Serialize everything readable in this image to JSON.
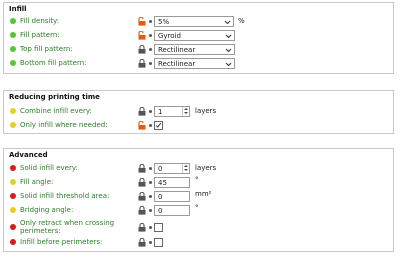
{
  "colors": {
    "dot_green": "#59c33b",
    "dot_yellow": "#e3cf2b",
    "dot_red": "#d11f1f",
    "label_green": "#2f7d2a",
    "lock_open": "#e15a13",
    "lock_closed": "#555555"
  },
  "infill": {
    "title": "Infill",
    "rows": [
      {
        "label": "Fill density:",
        "value": "5%",
        "unit": "%",
        "dot": "green",
        "lock": "open"
      },
      {
        "label": "Fill pattern:",
        "value": "Gyroid",
        "dot": "green",
        "lock": "open"
      },
      {
        "label": "Top fill pattern:",
        "value": "Rectilinear",
        "dot": "green",
        "lock": "closed"
      },
      {
        "label": "Bottom fill pattern:",
        "value": "Rectilinear",
        "dot": "green",
        "lock": "closed"
      }
    ]
  },
  "reducing": {
    "title": "Reducing printing time",
    "rows": [
      {
        "label": "Combine infill every:",
        "value": "1",
        "unit": "layers",
        "dot": "yellow",
        "lock": "closed"
      },
      {
        "label": "Only infill where needed:",
        "checked": true,
        "dot": "yellow",
        "lock": "open"
      }
    ]
  },
  "advanced": {
    "title": "Advanced",
    "rows": [
      {
        "label": "Solid infill every:",
        "value": "0",
        "unit": "layers",
        "dot": "red",
        "lock": "closed"
      },
      {
        "label": "Fill angle:",
        "value": "45",
        "unit": "°",
        "dot": "yellow",
        "lock": "closed"
      },
      {
        "label": "Solid infill threshold area:",
        "value": "0",
        "unit": "mm²",
        "dot": "red",
        "lock": "closed"
      },
      {
        "label": "Bridging angle:",
        "value": "0",
        "unit": "°",
        "dot": "yellow",
        "lock": "closed"
      },
      {
        "label_line1": "Only retract when crossing",
        "label_line2": "perimeters:",
        "checked": false,
        "dot": "red",
        "lock": "closed"
      },
      {
        "label": "Infill before perimeters:",
        "checked": false,
        "dot": "red",
        "lock": "closed"
      }
    ]
  }
}
